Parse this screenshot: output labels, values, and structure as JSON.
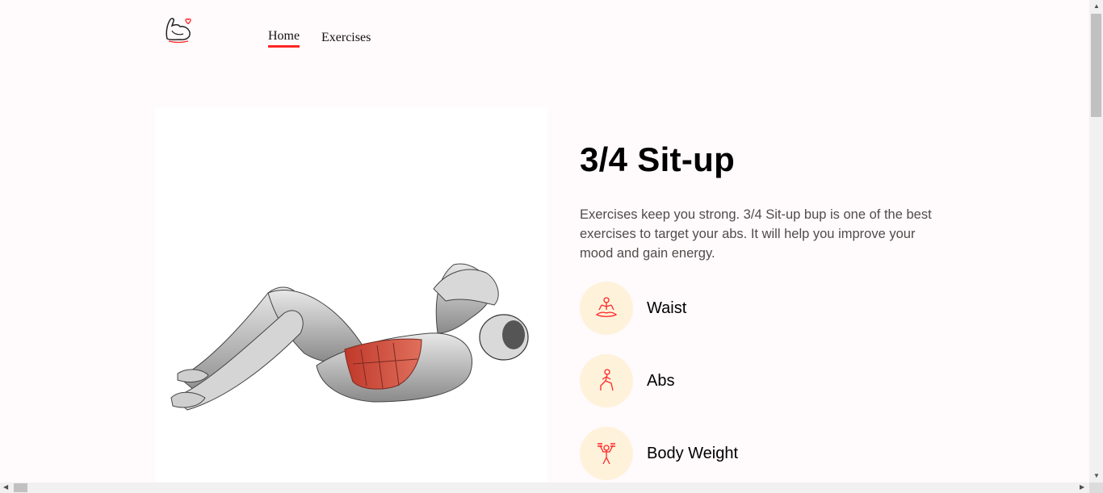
{
  "nav": {
    "logo_icon": "flexed-arm-heart-icon",
    "home_label": "Home",
    "exercises_label": "Exercises",
    "accent_color": "#ff2625"
  },
  "exercise": {
    "title": "3/4 Sit-up",
    "description": "Exercises keep you strong. 3/4 Sit-up bup is one of the best exercises to target your abs. It will help you improve your mood and gain energy.",
    "image_icon": "sit-up-muscle-illustration",
    "tags": [
      {
        "label": "Waist",
        "icon": "meditation-pose-icon"
      },
      {
        "label": "Abs",
        "icon": "lunge-pose-icon"
      },
      {
        "label": "Body Weight",
        "icon": "dumbbell-lift-icon"
      }
    ],
    "tag_background": "#fff2db"
  }
}
